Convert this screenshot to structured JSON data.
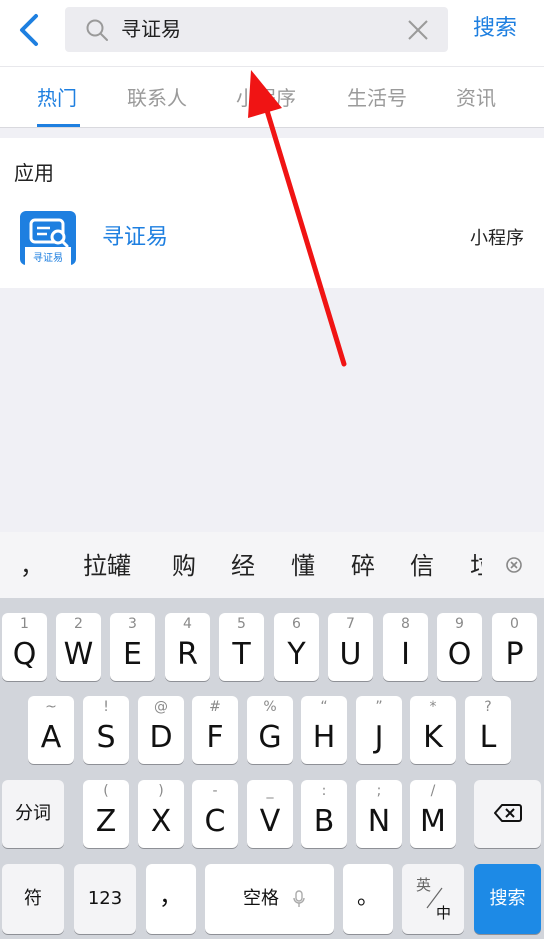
{
  "search": {
    "query": "寻证易",
    "submit_label": "搜索"
  },
  "tabs": [
    {
      "label": "热门"
    },
    {
      "label": "联系人"
    },
    {
      "label": "小程序"
    },
    {
      "label": "生活号"
    },
    {
      "label": "资讯"
    }
  ],
  "results": {
    "section_title": "应用",
    "items": [
      {
        "name": "寻证易",
        "icon_text": "寻证易",
        "type": "小程序"
      }
    ]
  },
  "keyboard": {
    "candidates": [
      "，",
      "拉罐",
      "购",
      "经",
      "懂",
      "碎",
      "信",
      "垃"
    ],
    "row1": [
      {
        "hint": "1",
        "key": "Q"
      },
      {
        "hint": "2",
        "key": "W"
      },
      {
        "hint": "3",
        "key": "E"
      },
      {
        "hint": "4",
        "key": "R"
      },
      {
        "hint": "5",
        "key": "T"
      },
      {
        "hint": "6",
        "key": "Y"
      },
      {
        "hint": "7",
        "key": "U"
      },
      {
        "hint": "8",
        "key": "I"
      },
      {
        "hint": "9",
        "key": "O"
      },
      {
        "hint": "0",
        "key": "P"
      }
    ],
    "row2": [
      {
        "hint": "~",
        "key": "A"
      },
      {
        "hint": "!",
        "key": "S"
      },
      {
        "hint": "@",
        "key": "D"
      },
      {
        "hint": "#",
        "key": "F"
      },
      {
        "hint": "%",
        "key": "G"
      },
      {
        "hint": "“",
        "key": "H"
      },
      {
        "hint": "”",
        "key": "J"
      },
      {
        "hint": "*",
        "key": "K"
      },
      {
        "hint": "?",
        "key": "L"
      }
    ],
    "row3": [
      {
        "hint": "(",
        "key": "Z"
      },
      {
        "hint": ")",
        "key": "X"
      },
      {
        "hint": "-",
        "key": "C"
      },
      {
        "hint": "_",
        "key": "V"
      },
      {
        "hint": ":",
        "key": "B"
      },
      {
        "hint": ";",
        "key": "N"
      },
      {
        "hint": "/",
        "key": "M"
      }
    ],
    "segment_label": "分词",
    "symbol_label": "符",
    "numbers_label": "123",
    "comma_label": "，",
    "space_label": "空格",
    "period_label": "。",
    "lang_top": "英",
    "lang_bottom": "中",
    "search_label": "搜索"
  },
  "colors": {
    "accent": "#1e7fe0",
    "arrow": "#f01414",
    "keyboard_bg": "#d2d5db"
  }
}
